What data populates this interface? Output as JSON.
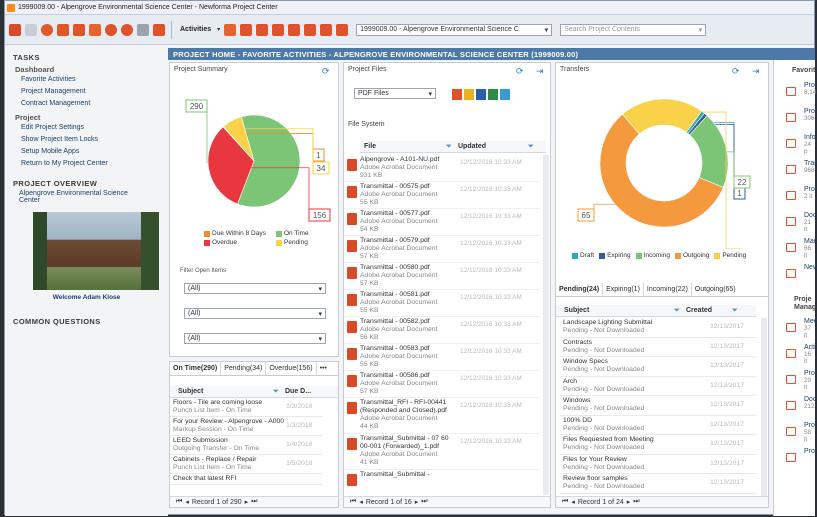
{
  "window": {
    "title": "1999009.00 - Alpengrove Environmental Science Center - Newforma Project Center"
  },
  "toolbar": {
    "activities_label": "Activities",
    "project_select": "1999009.00 - Alpengrove Environmental Science C",
    "search_placeholder": "Search Project Contents"
  },
  "left": {
    "tasks_heading": "TASKS",
    "dashboard_heading": "Dashboard",
    "dashboard_links": [
      "Favorite Activities",
      "Project Management",
      "Contract Management"
    ],
    "project_heading": "Project",
    "project_links": [
      "Edit Project Settings",
      "Show Project Item Locks",
      "Setup Mobile Apps",
      "Return to My Project Center"
    ],
    "overview_heading": "PROJECT OVERVIEW",
    "overview_name": "Alpengrove Environmental Science Center",
    "welcome": "Welcome Adam Klose",
    "common_heading": "COMMON QUESTIONS"
  },
  "header": {
    "title": "PROJECT HOME - FAVORITE ACTIVITIES - ALPENGROVE ENVIRONMENTAL SCIENCE CENTER (1999009.00)"
  },
  "summary": {
    "title": "Project Summary",
    "legend": [
      "Due Within 8 Days",
      "On Time",
      "Overdue",
      "Pending"
    ],
    "filter_label": "Filter Open Items",
    "filters": [
      "(All)",
      "(All)",
      "(All)"
    ],
    "tabs": [
      "On Time(290)",
      "Pending(34)",
      "Overdue(156)"
    ],
    "more": "•••",
    "col_subject": "Subject",
    "col_due": "Due D...",
    "rows": [
      {
        "t": "Floors - Tile are coming loose",
        "s": "Punch List Item - On Time",
        "d": "1/3/2018"
      },
      {
        "t": "For your Review - Alpengrove - A000",
        "s": "Markup Session - On Time",
        "d": "1/3/2018"
      },
      {
        "t": "LEED Submission",
        "s": "Outgoing Transfer - On Time",
        "d": "1/4/2018"
      },
      {
        "t": "Cabinets - Replace / Repair",
        "s": "Punch List Item - On Time",
        "d": "1/5/2018"
      },
      {
        "t": "Check that latest RFI",
        "s": "",
        "d": ""
      }
    ],
    "pager": "Record 1 of 290"
  },
  "chart_data": [
    {
      "type": "pie",
      "title": "",
      "categories": [
        "On Time",
        "Overdue",
        "Due Within 8 Days",
        "Pending"
      ],
      "values": [
        290,
        156,
        1,
        34
      ],
      "colors": [
        "#7cc576",
        "#e8373f",
        "#f28a30",
        "#f9d24a"
      ]
    },
    {
      "type": "pie",
      "title": "",
      "categories": [
        "Draft",
        "Expiring",
        "Incoming",
        "Outgoing",
        "Pending"
      ],
      "values": [
        1,
        1,
        22,
        65,
        24
      ],
      "colors": [
        "#2aa7b8",
        "#2e5d91",
        "#7cc576",
        "#f4993e",
        "#f9d24a"
      ],
      "donut": true
    }
  ],
  "files": {
    "title": "Project Files",
    "filter": "PDF Files",
    "subtitle": "File System",
    "col_file": "File",
    "col_updated": "Updated",
    "rows": [
      {
        "n": "Alpengrove - A101-NU.pdf",
        "t": "Adobe Acrobat Document",
        "z": "931 KB",
        "u": "12/12/2016 10:33 AM"
      },
      {
        "n": "Transmittal - 00575.pdf",
        "t": "Adobe Acrobat Document",
        "z": "55 KB",
        "u": "12/12/2016 10:33 AM"
      },
      {
        "n": "Transmittal - 00577.pdf",
        "t": "Adobe Acrobat Document",
        "z": "54 KB",
        "u": "12/12/2016 10:33 AM"
      },
      {
        "n": "Transmittal - 00579.pdf",
        "t": "Adobe Acrobat Document",
        "z": "57 KB",
        "u": "12/12/2016 10:33 AM"
      },
      {
        "n": "Transmittal - 00580.pdf",
        "t": "Adobe Acrobat Document",
        "z": "57 KB",
        "u": "12/12/2016 10:33 AM"
      },
      {
        "n": "Transmittal - 00581.pdf",
        "t": "Adobe Acrobat Document",
        "z": "55 KB",
        "u": "12/12/2016 10:33 AM"
      },
      {
        "n": "Transmittal - 00582.pdf",
        "t": "Adobe Acrobat Document",
        "z": "56 KB",
        "u": "12/12/2016 10:33 AM"
      },
      {
        "n": "Transmittal - 00583.pdf",
        "t": "Adobe Acrobat Document",
        "z": "55 KB",
        "u": "12/12/2016 10:33 AM"
      },
      {
        "n": "Transmittal - 00586.pdf",
        "t": "Adobe Acrobat Document",
        "z": "57 KB",
        "u": "12/12/2016 10:33 AM"
      },
      {
        "n": "Transmittal_RFI - RFI-00441 (Responded and Closed).pdf",
        "t": "Adobe Acrobat Document",
        "z": "44 KB",
        "u": "12/12/2016 10:33 AM"
      },
      {
        "n": "Transmittal_Submittal - 07 60 00-001 (Forwarded)_1.pdf",
        "t": "Adobe Acrobat Document",
        "z": "41 KB",
        "u": "12/12/2016 10:33 AM"
      },
      {
        "n": "Transmittal_Submittal -",
        "t": "",
        "z": "",
        "u": ""
      }
    ],
    "pager": "Record 1 of 16"
  },
  "transfers": {
    "title": "Transfers",
    "legend": [
      "Draft",
      "Expiring",
      "Incoming",
      "Outgoing",
      "Pending"
    ],
    "tabs": [
      "Pending(24)",
      "Expiring(1)",
      "Incoming(22)",
      "Outgoing(65)"
    ],
    "col_subject": "Subject",
    "col_created": "Created",
    "rows": [
      {
        "t": "Landscape Lighting Submittal",
        "s": "Pending - Not Downloaded",
        "d": "12/13/2017"
      },
      {
        "t": "Contracts",
        "s": "Pending - Not Downloaded",
        "d": "12/13/2017"
      },
      {
        "t": "Window Specs",
        "s": "Pending - Not Downloaded",
        "d": "12/13/2017"
      },
      {
        "t": "Arch",
        "s": "Pending - Not Downloaded",
        "d": "12/13/2017"
      },
      {
        "t": "Windows",
        "s": "Pending - Not Downloaded",
        "d": "12/13/2017"
      },
      {
        "t": "100% DD",
        "s": "Pending - Not Downloaded",
        "d": "12/13/2017"
      },
      {
        "t": "Files Requested from Meeting",
        "s": "Pending - Not Downloaded",
        "d": "12/13/2017"
      },
      {
        "t": "Files for Your Review",
        "s": "Pending - Not Downloaded",
        "d": "12/13/2017"
      },
      {
        "t": "Review floor samples",
        "s": "Pending - Not Downloaded",
        "d": "12/13/2017"
      }
    ],
    "pager": "Record 1 of 24"
  },
  "favorites": {
    "heading": "Favorit",
    "items": [
      {
        "n": "Proj",
        "c": "8,14"
      },
      {
        "n": "Proj",
        "c": "306"
      },
      {
        "n": "Info",
        "c": "24 p"
      },
      {
        "n": "Tran",
        "c": "968"
      },
      {
        "n": "Proj",
        "c": "2 it"
      },
      {
        "n": "Doc",
        "c": "21 it"
      },
      {
        "n": "Mar",
        "c": "66 it"
      },
      {
        "n": "New",
        "c": ""
      }
    ],
    "heading2": "Proje Manag",
    "items2": [
      {
        "n": "Mee",
        "c": "37 it"
      },
      {
        "n": "Acti",
        "c": "16 it"
      },
      {
        "n": "Proj",
        "c": "29 it"
      },
      {
        "n": "Doc",
        "c": "212"
      },
      {
        "n": "Proj",
        "c": "58 it"
      },
      {
        "n": "Proj",
        "c": ""
      }
    ]
  }
}
